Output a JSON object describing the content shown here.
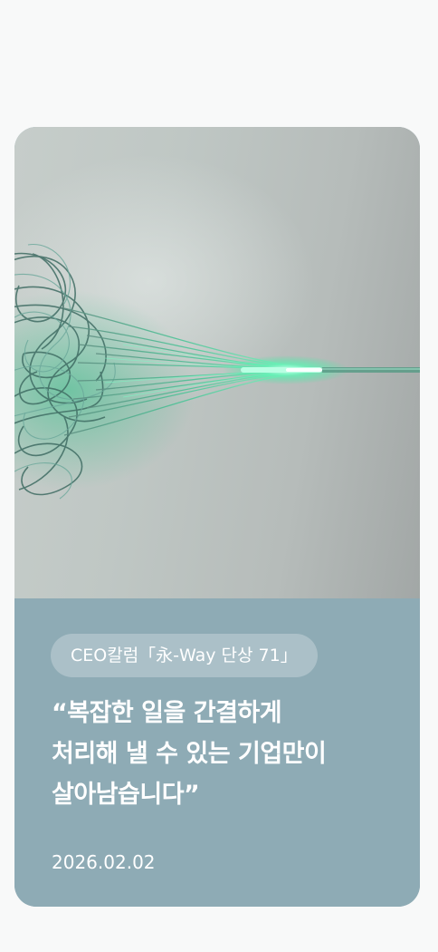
{
  "article": {
    "tag": "CEO칼럼「永-Way 단상 71」",
    "headline": {
      "line1": "“복잡한 일을 간결하게",
      "line2": "처리해 낼 수 있는 기업만이",
      "line3": "살아남습니다”"
    },
    "date": "2026.02.02"
  },
  "hero_image": {
    "subject": "tangled-fiber-optic-cables-converging-into-glowing-green-light-line"
  },
  "colors": {
    "page_background": "#f8f9f9",
    "card_info_background": "#8eabb5",
    "glow_accent": "#3ee8a0",
    "text": "#ffffff"
  }
}
